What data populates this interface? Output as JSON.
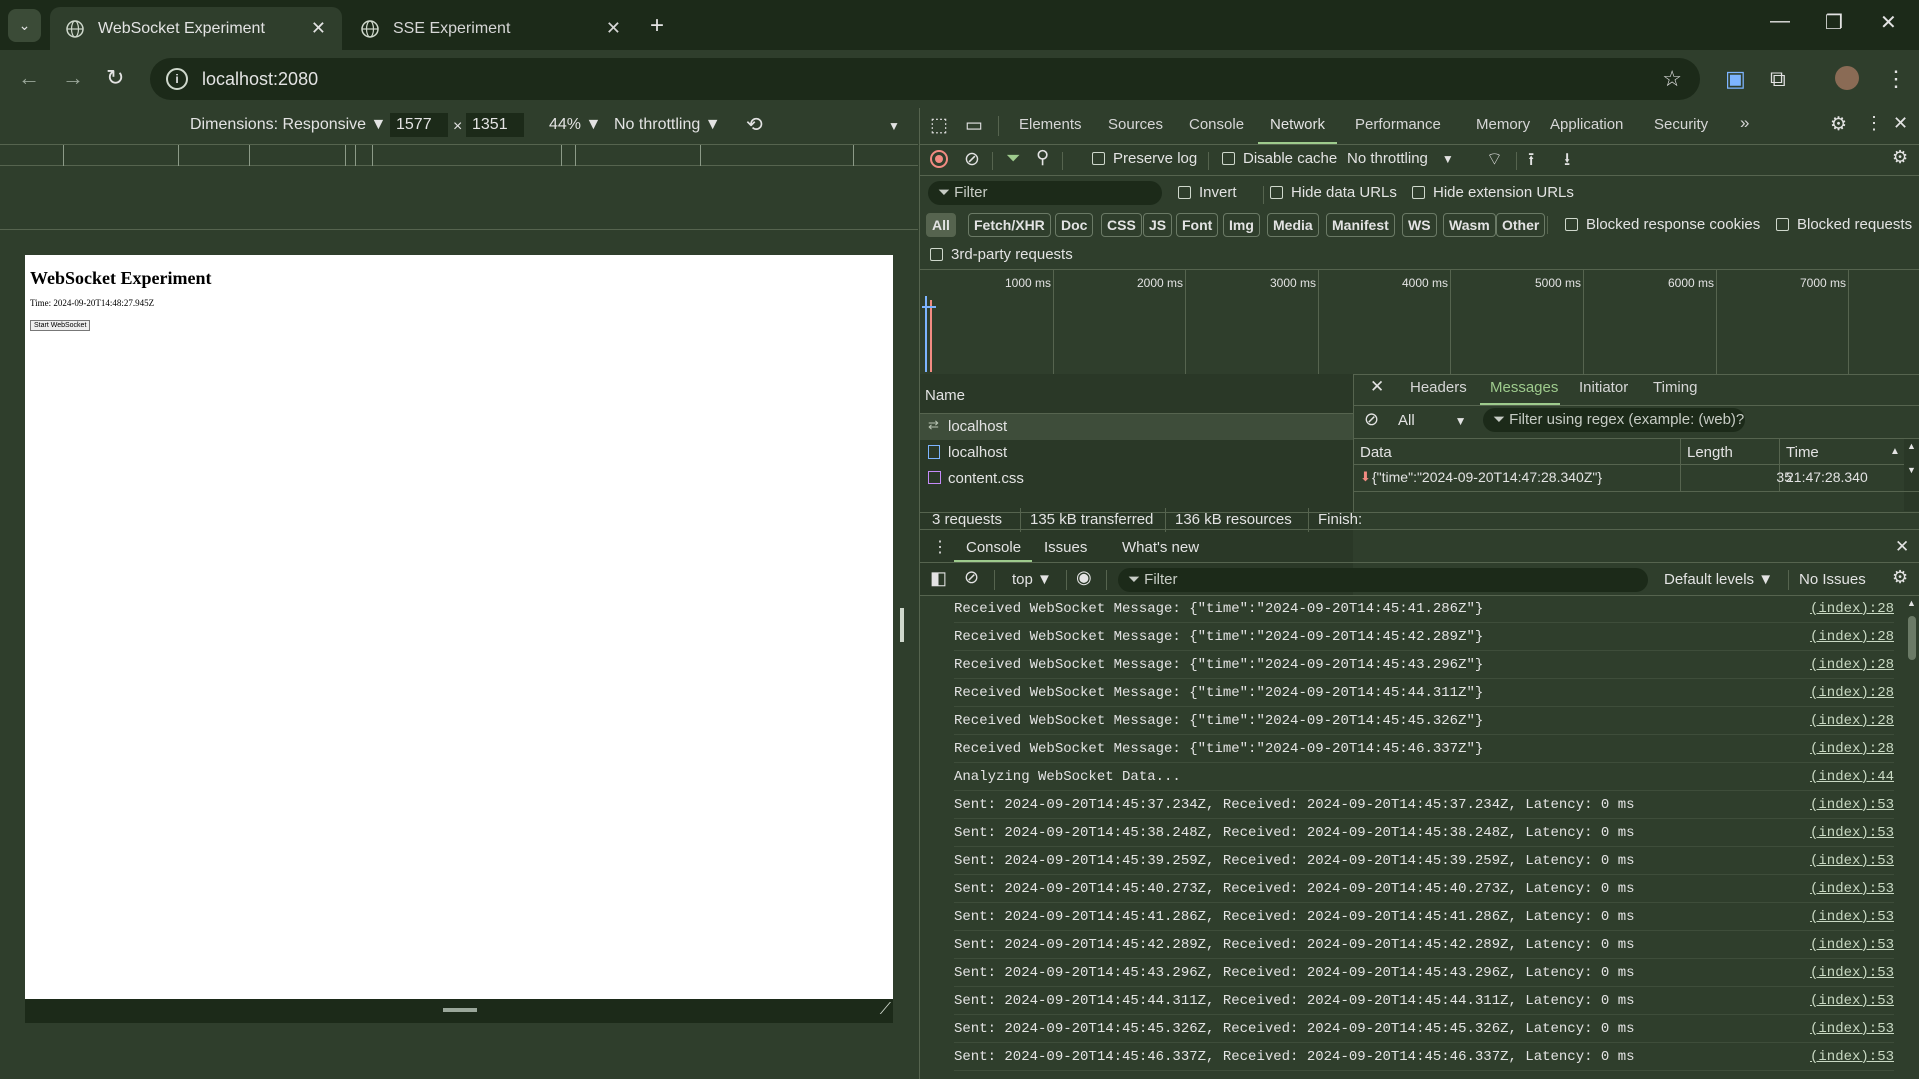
{
  "browser": {
    "tabs": [
      {
        "title": "WebSocket Experiment",
        "active": true
      },
      {
        "title": "SSE Experiment",
        "active": false
      }
    ],
    "url": "localhost:2080"
  },
  "device_toolbar": {
    "dimensions_label": "Dimensions: Responsive ▼",
    "width": "1577",
    "times": "×",
    "height": "1351",
    "zoom": "44% ▼",
    "throttling": "No throttling ▼"
  },
  "page": {
    "heading": "WebSocket Experiment",
    "time_line": "Time: 2024-09-20T14:48:27.945Z",
    "button_label": "Start WebSocket"
  },
  "devtools": {
    "tabs": [
      "Elements",
      "Sources",
      "Console",
      "Network",
      "Performance",
      "Memory",
      "Application",
      "Security"
    ],
    "selected_tab": "Network",
    "more": "»",
    "network_toolbar": {
      "preserve_log": "Preserve log",
      "disable_cache": "Disable cache",
      "throttling": "No throttling"
    },
    "filter_row": {
      "filter_placeholder": "Filter",
      "invert": "Invert",
      "hide_data_urls": "Hide data URLs",
      "hide_extension_urls": "Hide extension URLs"
    },
    "type_chips": [
      "All",
      "Fetch/XHR",
      "Doc",
      "CSS",
      "JS",
      "Font",
      "Img",
      "Media",
      "Manifest",
      "WS",
      "Wasm",
      "Other"
    ],
    "blocked_cookies": "Blocked response cookies",
    "blocked_requests": "Blocked requests",
    "third_party": "3rd-party requests",
    "timeline_labels": [
      "1000 ms",
      "2000 ms",
      "3000 ms",
      "4000 ms",
      "5000 ms",
      "6000 ms",
      "7000 ms"
    ],
    "requests_header": "Name",
    "requests": [
      "localhost",
      "localhost",
      "content.css"
    ],
    "detail_tabs": [
      "Headers",
      "Messages",
      "Initiator",
      "Timing"
    ],
    "detail_selected": "Messages",
    "messages_filter_type": "All",
    "messages_filter_placeholder": "Filter using regex (example: (web)?",
    "messages_columns": [
      "Data",
      "Length",
      "Time"
    ],
    "messages": [
      {
        "data": "{\"time\":\"2024-09-20T14:47:28.340Z\"}",
        "length": "35",
        "time": "21:47:28.340"
      }
    ],
    "status_bar": {
      "requests": "3 requests",
      "transferred": "135 kB transferred",
      "resources": "136 kB resources",
      "finish": "Finish:"
    },
    "drawer_tabs": [
      "Console",
      "Issues",
      "What's new"
    ],
    "console_toolbar": {
      "context": "top ▼",
      "filter_placeholder": "Filter",
      "levels": "Default levels ▼",
      "issues": "No Issues"
    },
    "console_lines": [
      {
        "msg": "Received WebSocket Message: {\"time\":\"2024-09-20T14:45:41.286Z\"}",
        "src": "(index):28"
      },
      {
        "msg": "Received WebSocket Message: {\"time\":\"2024-09-20T14:45:42.289Z\"}",
        "src": "(index):28"
      },
      {
        "msg": "Received WebSocket Message: {\"time\":\"2024-09-20T14:45:43.296Z\"}",
        "src": "(index):28"
      },
      {
        "msg": "Received WebSocket Message: {\"time\":\"2024-09-20T14:45:44.311Z\"}",
        "src": "(index):28"
      },
      {
        "msg": "Received WebSocket Message: {\"time\":\"2024-09-20T14:45:45.326Z\"}",
        "src": "(index):28"
      },
      {
        "msg": "Received WebSocket Message: {\"time\":\"2024-09-20T14:45:46.337Z\"}",
        "src": "(index):28"
      },
      {
        "msg": "Analyzing WebSocket Data...",
        "src": "(index):44"
      },
      {
        "msg": "Sent: 2024-09-20T14:45:37.234Z, Received: 2024-09-20T14:45:37.234Z, Latency: 0 ms",
        "src": "(index):53"
      },
      {
        "msg": "Sent: 2024-09-20T14:45:38.248Z, Received: 2024-09-20T14:45:38.248Z, Latency: 0 ms",
        "src": "(index):53"
      },
      {
        "msg": "Sent: 2024-09-20T14:45:39.259Z, Received: 2024-09-20T14:45:39.259Z, Latency: 0 ms",
        "src": "(index):53"
      },
      {
        "msg": "Sent: 2024-09-20T14:45:40.273Z, Received: 2024-09-20T14:45:40.273Z, Latency: 0 ms",
        "src": "(index):53"
      },
      {
        "msg": "Sent: 2024-09-20T14:45:41.286Z, Received: 2024-09-20T14:45:41.286Z, Latency: 0 ms",
        "src": "(index):53"
      },
      {
        "msg": "Sent: 2024-09-20T14:45:42.289Z, Received: 2024-09-20T14:45:42.289Z, Latency: 0 ms",
        "src": "(index):53"
      },
      {
        "msg": "Sent: 2024-09-20T14:45:43.296Z, Received: 2024-09-20T14:45:43.296Z, Latency: 0 ms",
        "src": "(index):53"
      },
      {
        "msg": "Sent: 2024-09-20T14:45:44.311Z, Received: 2024-09-20T14:45:44.311Z, Latency: 0 ms",
        "src": "(index):53"
      },
      {
        "msg": "Sent: 2024-09-20T14:45:45.326Z, Received: 2024-09-20T14:45:45.326Z, Latency: 0 ms",
        "src": "(index):53"
      },
      {
        "msg": "Sent: 2024-09-20T14:45:46.337Z, Received: 2024-09-20T14:45:46.337Z, Latency: 0 ms",
        "src": "(index):53"
      }
    ]
  }
}
